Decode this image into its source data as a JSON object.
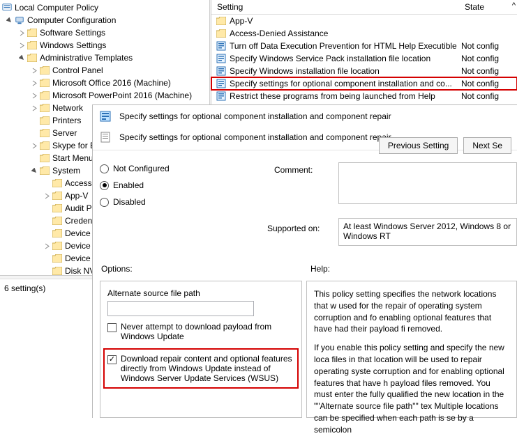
{
  "tree": {
    "root": "Local Computer Policy",
    "computer_config": "Computer Configuration",
    "software_settings": "Software Settings",
    "windows_settings": "Windows Settings",
    "admin_templates": "Administrative Templates",
    "control_panel": "Control Panel",
    "office": "Microsoft Office 2016 (Machine)",
    "powerpoint": "Microsoft PowerPoint 2016 (Machine)",
    "network": "Network",
    "printers": "Printers",
    "server": "Server",
    "skype": "Skype for B",
    "start_menu": "Start Menu",
    "system": "System",
    "access": "Access-",
    "appv": "App-V",
    "audit": "Audit P",
    "creden": "Creden",
    "device1": "Device",
    "device2": "Device",
    "device3": "Device",
    "disk": "Disk NV"
  },
  "status": {
    "count": "6 setting(s)"
  },
  "list": {
    "header_setting": "Setting",
    "header_state": "State",
    "rows": [
      {
        "label": "App-V",
        "state": "",
        "kind": "folder"
      },
      {
        "label": "Access-Denied Assistance",
        "state": "",
        "kind": "folder"
      },
      {
        "label": "Turn off Data Execution Prevention for HTML Help Executible",
        "state": "Not config",
        "kind": "setting"
      },
      {
        "label": "Specify Windows Service Pack installation file location",
        "state": "Not config",
        "kind": "setting"
      },
      {
        "label": "Specify Windows installation file location",
        "state": "Not config",
        "kind": "setting"
      },
      {
        "label": "Specify settings for optional component installation and co...",
        "state": "Not config",
        "kind": "setting",
        "hl": true
      },
      {
        "label": "Restrict these programs from being launched from Help",
        "state": "Not config",
        "kind": "setting"
      }
    ]
  },
  "dialog": {
    "title": "Specify settings for optional component installation and component repair",
    "subtitle": "Specify settings for optional component installation and component repair",
    "btn_prev": "Previous Setting",
    "btn_next": "Next Se",
    "radio_not": "Not Configured",
    "radio_enabled": "Enabled",
    "radio_disabled": "Disabled",
    "comment_lbl": "Comment:",
    "supported_lbl": "Supported on:",
    "supported_val": "At least Windows Server 2012, Windows 8 or Windows RT",
    "options_lbl": "Options:",
    "help_lbl": "Help:",
    "opt_altpath": "Alternate source file path",
    "opt_never": "Never attempt to download payload from Windows Update",
    "opt_wsus": "Download repair content and optional features directly from Windows Update instead of Windows Server Update Services (WSUS)",
    "help_p1": "This policy setting specifies the network locations that w used for the repair of operating system corruption and fo enabling optional features that have had their payload fi removed.",
    "help_p2": "If you enable this policy setting and specify the new loca files in that location will be used to repair operating syste corruption and for enabling optional features that have h payload files removed. You must enter the fully qualified the new location in the \"\"Alternate source file path\"\" tex Multiple locations can be specified when each path is se by a semicolon"
  }
}
